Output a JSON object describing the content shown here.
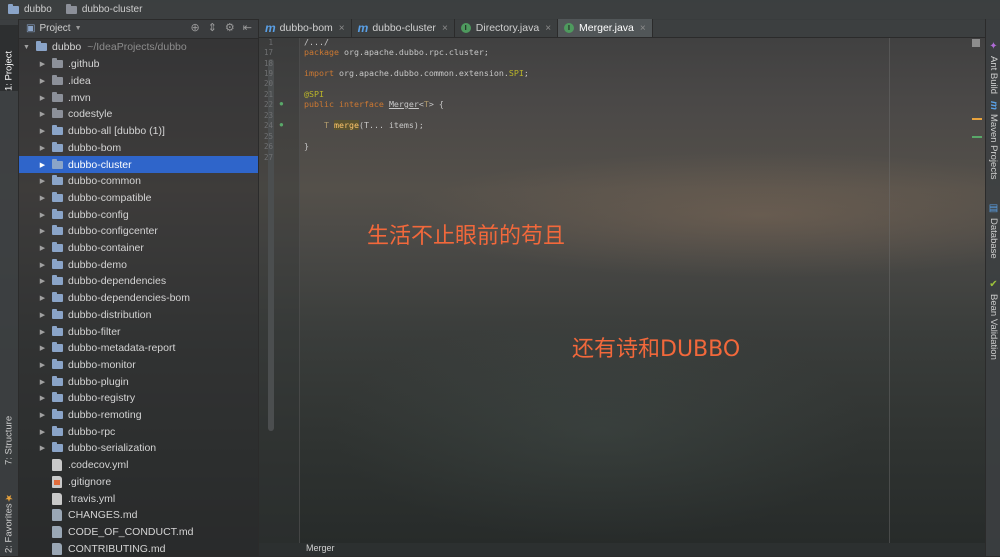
{
  "breadcrumbs": [
    "dubbo",
    "dubbo-cluster"
  ],
  "left_tool_tabs": [
    "1: Project",
    "7: Structure",
    "2: Favorites"
  ],
  "right_tool_tabs": [
    "Ant Build",
    "Maven Projects",
    "Database",
    "Bean Validation"
  ],
  "project_panel": {
    "title": "Project",
    "root_label": "dubbo",
    "root_path": "~/IdeaProjects/dubbo",
    "items": [
      {
        "label": ".github",
        "type": "folder"
      },
      {
        "label": ".idea",
        "type": "folder"
      },
      {
        "label": ".mvn",
        "type": "folder"
      },
      {
        "label": "codestyle",
        "type": "folder"
      },
      {
        "label": "dubbo-all [dubbo (1)]",
        "type": "module"
      },
      {
        "label": "dubbo-bom",
        "type": "module"
      },
      {
        "label": "dubbo-cluster",
        "type": "module",
        "selected": true
      },
      {
        "label": "dubbo-common",
        "type": "module"
      },
      {
        "label": "dubbo-compatible",
        "type": "module"
      },
      {
        "label": "dubbo-config",
        "type": "module"
      },
      {
        "label": "dubbo-configcenter",
        "type": "module"
      },
      {
        "label": "dubbo-container",
        "type": "module"
      },
      {
        "label": "dubbo-demo",
        "type": "module"
      },
      {
        "label": "dubbo-dependencies",
        "type": "module"
      },
      {
        "label": "dubbo-dependencies-bom",
        "type": "module"
      },
      {
        "label": "dubbo-distribution",
        "type": "module"
      },
      {
        "label": "dubbo-filter",
        "type": "module"
      },
      {
        "label": "dubbo-metadata-report",
        "type": "module"
      },
      {
        "label": "dubbo-monitor",
        "type": "module"
      },
      {
        "label": "dubbo-plugin",
        "type": "module"
      },
      {
        "label": "dubbo-registry",
        "type": "module"
      },
      {
        "label": "dubbo-remoting",
        "type": "module"
      },
      {
        "label": "dubbo-rpc",
        "type": "module"
      },
      {
        "label": "dubbo-serialization",
        "type": "module"
      },
      {
        "label": ".codecov.yml",
        "type": "file"
      },
      {
        "label": ".gitignore",
        "type": "git"
      },
      {
        "label": ".travis.yml",
        "type": "file"
      },
      {
        "label": "CHANGES.md",
        "type": "md"
      },
      {
        "label": "CODE_OF_CONDUCT.md",
        "type": "md"
      },
      {
        "label": "CONTRIBUTING.md",
        "type": "md"
      }
    ]
  },
  "editor_tabs": [
    {
      "label": "dubbo-bom",
      "icon": "m",
      "active": false
    },
    {
      "label": "dubbo-cluster",
      "icon": "m",
      "active": false
    },
    {
      "label": "Directory.java",
      "icon": "I",
      "active": false
    },
    {
      "label": "Merger.java",
      "icon": "I",
      "active": true
    }
  ],
  "code": {
    "line_numbers": [
      "1",
      "17",
      "18",
      "19",
      "20",
      "21",
      "22",
      "23",
      "24",
      "25",
      "26",
      "27"
    ],
    "fold": "/.../",
    "package_kw": "package",
    "package_name": " org.apache.dubbo.rpc.cluster;",
    "import_kw": "import",
    "import_name": " org.apache.dubbo.common.extension.",
    "import_spi": "SPI",
    "import_end": ";",
    "annotation": "@SPI",
    "decl_kw": "public interface",
    "iface_name": "Merger",
    "type_param_open": "<",
    "type_param": "T",
    "type_param_close": "> {",
    "method_ret": "T",
    "method_name": "merge",
    "method_params": "(T... items);",
    "close_brace": "}"
  },
  "breadcrumb_status": "Merger",
  "overlay": {
    "line1": "生活不止眼前的苟且",
    "line2": "还有诗和DUBBO"
  }
}
